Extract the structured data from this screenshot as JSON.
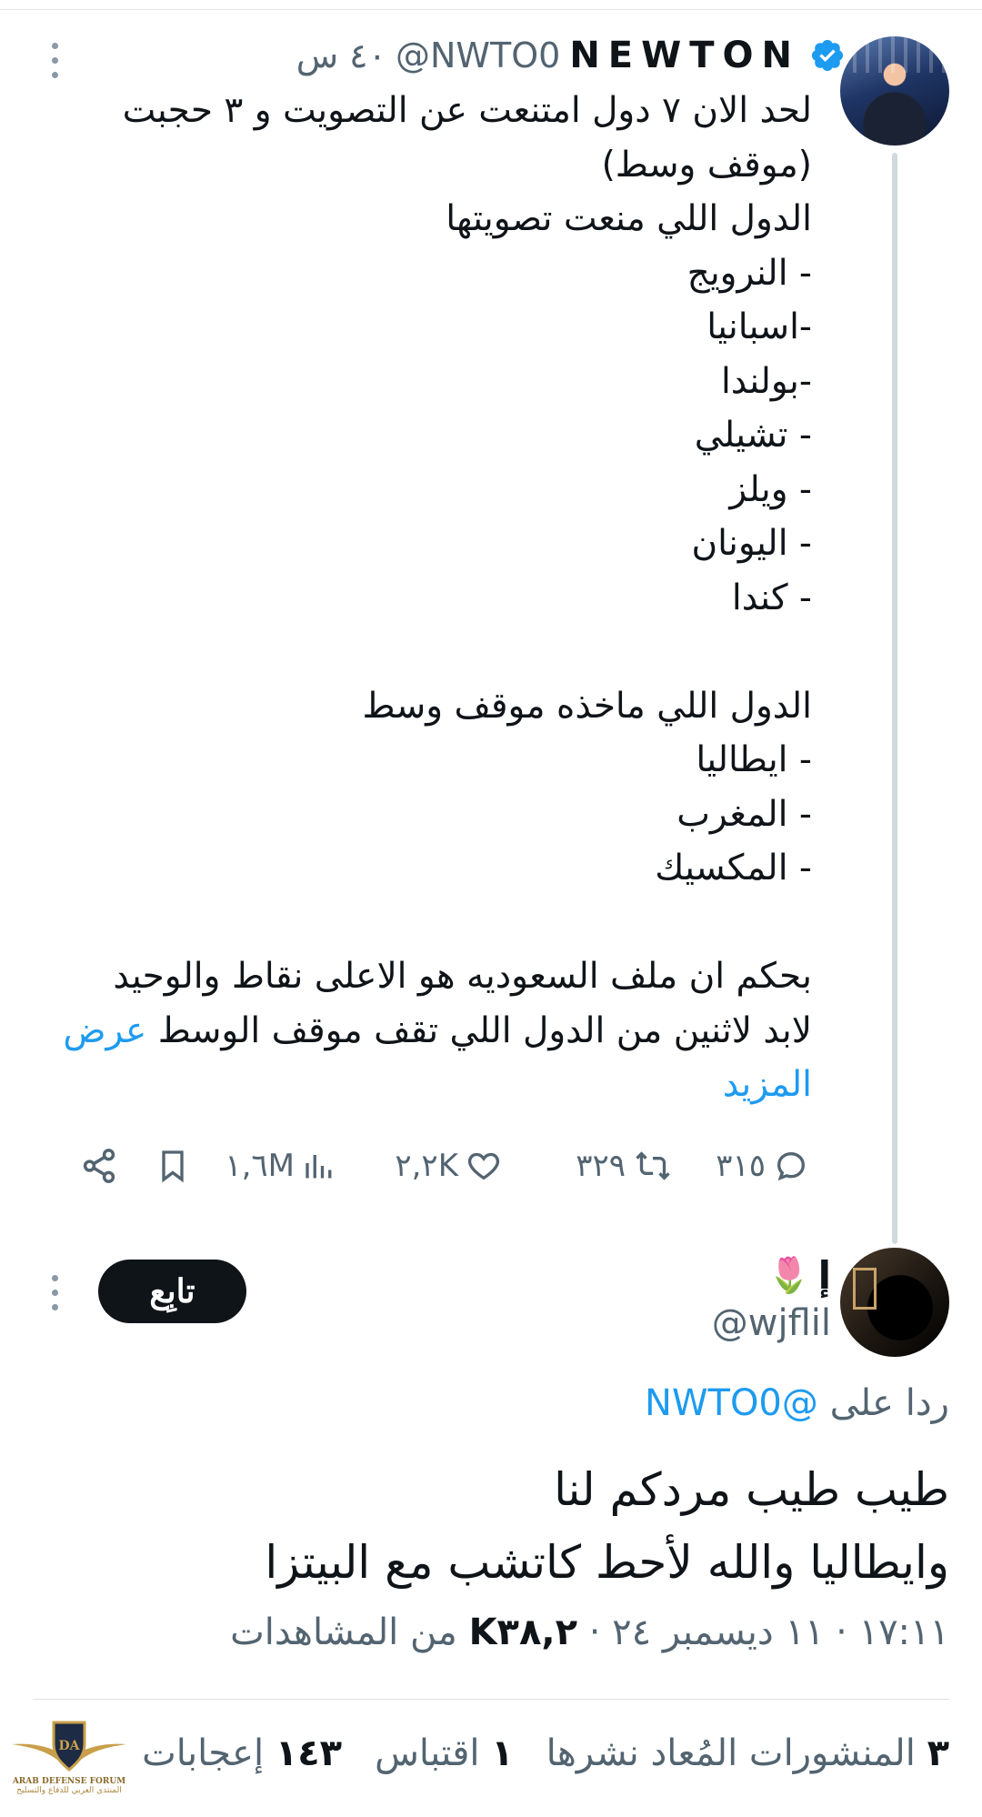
{
  "tweet": {
    "display_name": "NEWTON",
    "handle": "@NWTO0",
    "time": "٤٠ س",
    "body_lines": [
      "لحد الان ٧ دول امتنعت عن التصويت و ٣ حجبت",
      "(موقف وسط)",
      "الدول اللي منعت تصويتها",
      "- النرويج",
      "-اسبانيا",
      "-بولندا",
      "- تشيلي",
      "- ويلز",
      "- اليونان",
      "- كندا",
      "",
      "الدول اللي ماخذه موقف وسط",
      "- ايطاليا",
      "- المغرب",
      "- المكسيك",
      "",
      "بحكم ان ملف السعوديه هو الاعلى نقاط والوحيد",
      "لابد لاثنين من الدول اللي تقف موقف الوسط"
    ],
    "show_more_part1": "عرض",
    "show_more_part2": "المزيد",
    "replies": "٣١٥",
    "reposts": "٣٢٩",
    "likes": "٢,٢K",
    "views": "١,٦M"
  },
  "reply": {
    "name": "إ",
    "emoji": "🌷",
    "handle": "@wjflil",
    "follow_label": "تابِع",
    "reply_to_prefix": "ردا على",
    "reply_to_handle": "@NWTO0",
    "body_line1": "طيب طيب مردكم لنا",
    "body_line2": "وايطاليا والله لأحط كاتشب مع البيتزا",
    "meta_datetime": "١٧:١١ · ١١ ديسمبر ٢٤ · ",
    "meta_views": "K٣٨,٢",
    "meta_views_suffix": " من المشاهدات",
    "reposts_count": "٣",
    "reposts_label": "المنشورات المُعاد نشرها",
    "quotes_count": "١",
    "quotes_label": "اقتباس",
    "likes_count": "١٤٣",
    "likes_label": "إعجابات"
  },
  "watermark": {
    "title": "ARAB DEFENSE FORUM",
    "subtitle": "المنتدى العربي للدفاع والتسليح"
  },
  "colors": {
    "link": "#1d9bf0",
    "muted": "#536471",
    "text": "#0f1419"
  },
  "icons": [
    "verified-badge-icon",
    "more-vertical-icon",
    "reply-icon",
    "repost-icon",
    "like-icon",
    "views-icon",
    "bookmark-icon",
    "share-icon"
  ]
}
